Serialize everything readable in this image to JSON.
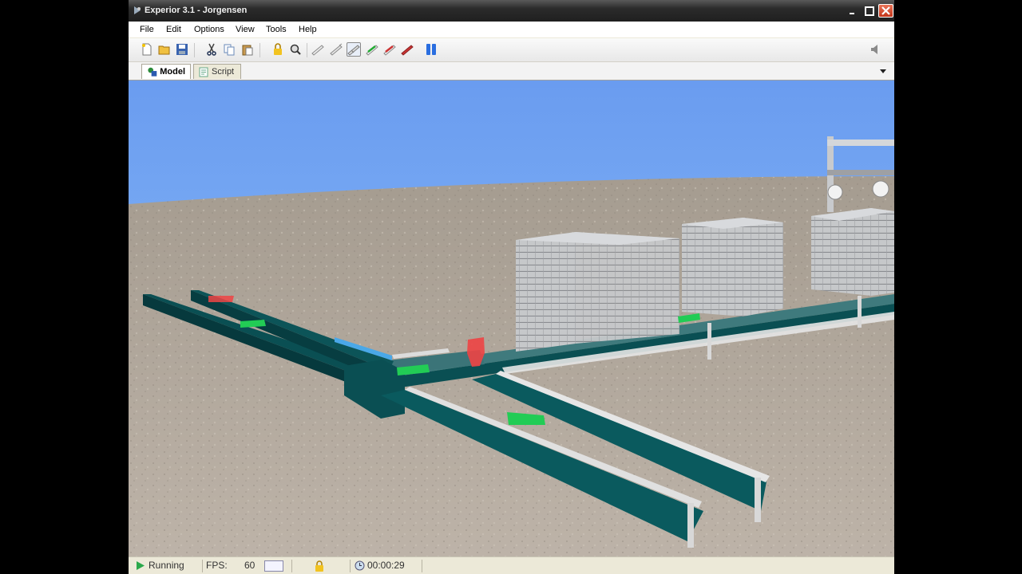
{
  "window": {
    "title": "Experior 3.1 - Jorgensen"
  },
  "menu": {
    "items": [
      "File",
      "Edit",
      "Options",
      "View",
      "Tools",
      "Help"
    ]
  },
  "toolbar": {
    "buttons": [
      "new-icon",
      "open-folder-icon",
      "save-icon",
      "cut-icon",
      "copy-icon",
      "paste-icon",
      "lock-icon",
      "find-icon",
      "conveyor-tool-icon",
      "conveyor-tool-icon",
      "conveyor-tool-icon",
      "green-conveyor-icon",
      "red-conveyor-icon",
      "red-conveyor-icon",
      "pause-icon"
    ],
    "speaker": "speaker-icon"
  },
  "tabs": {
    "model_label": "Model",
    "script_label": "Script"
  },
  "status": {
    "state": "Running",
    "fps_label": "FPS:",
    "fps_value": "60",
    "clock": "00:00:29"
  },
  "colors": {
    "sky": "#6fa0f0",
    "ground": "#b0a69a",
    "conveyor": "#0a5a5e",
    "load_green": "#22cc55",
    "load_red": "#ee4444"
  }
}
